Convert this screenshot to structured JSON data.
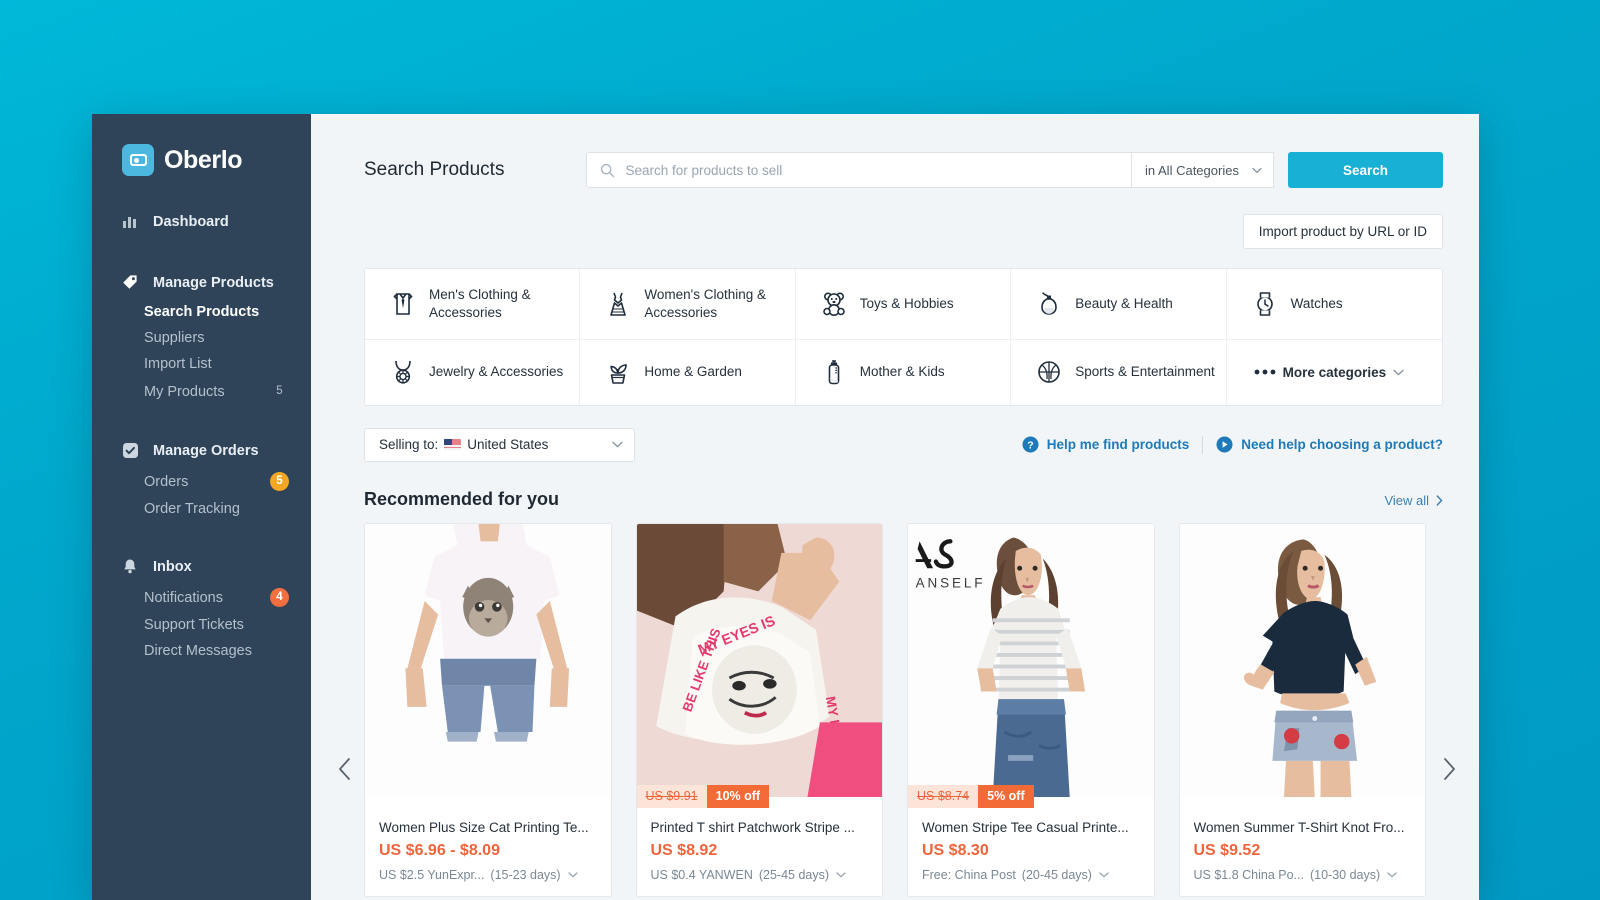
{
  "brand": {
    "name": "Oberlo",
    "logo_icon": "oberlo-logo-icon",
    "accent": "#4cb8e0"
  },
  "sidebar": {
    "groups": [
      {
        "label": "Dashboard",
        "icon": "bar-chart-icon",
        "children": []
      },
      {
        "label": "Manage Products",
        "icon": "tag-icon",
        "children": [
          {
            "label": "Search Products",
            "badge": "",
            "active": true
          },
          {
            "label": "Suppliers",
            "badge": "",
            "active": false
          },
          {
            "label": "Import List",
            "badge": "",
            "active": false
          },
          {
            "label": "My Products",
            "badge": "5",
            "badge_style": "plain",
            "active": false
          }
        ]
      },
      {
        "label": "Manage Orders",
        "icon": "check-square-icon",
        "children": [
          {
            "label": "Orders",
            "badge": "5",
            "badge_style": "amber",
            "active": false
          },
          {
            "label": "Order Tracking",
            "badge": "",
            "active": false
          }
        ]
      },
      {
        "label": "Inbox",
        "icon": "bell-icon",
        "children": [
          {
            "label": "Notifications",
            "badge": "4",
            "badge_style": "orange",
            "active": false
          },
          {
            "label": "Support Tickets",
            "badge": "",
            "active": false
          },
          {
            "label": "Direct Messages",
            "badge": "",
            "active": false
          }
        ]
      }
    ]
  },
  "header": {
    "page_title": "Search Products",
    "search": {
      "value": "",
      "placeholder": "Search for products to sell",
      "icon": "search-icon"
    },
    "category_select": {
      "value": "in All Categories",
      "icon": "chevron-down-icon"
    },
    "search_button": "Search",
    "import_button": "Import product by URL or ID"
  },
  "categories": [
    {
      "label": "Men's Clothing & Accessories",
      "icon": "shirt-tie-icon"
    },
    {
      "label": "Women's Clothing & Accessories",
      "icon": "dress-icon"
    },
    {
      "label": "Toys & Hobbies",
      "icon": "teddy-bear-icon"
    },
    {
      "label": "Beauty & Health",
      "icon": "perfume-bottle-icon"
    },
    {
      "label": "Watches",
      "icon": "watch-icon"
    },
    {
      "label": "Jewelry & Accessories",
      "icon": "necklace-icon"
    },
    {
      "label": "Home & Garden",
      "icon": "potted-plant-icon"
    },
    {
      "label": "Mother & Kids",
      "icon": "baby-bottle-icon"
    },
    {
      "label": "Sports & Entertainment",
      "icon": "basketball-icon"
    },
    {
      "label": "More categories",
      "icon": "ellipsis-icon",
      "is_more": true
    }
  ],
  "selling_to": {
    "prefix": "Selling to:",
    "country": "United States",
    "flag": "us-flag-icon",
    "icon": "chevron-down-icon"
  },
  "help_links": [
    {
      "label": "Help me find products",
      "icon": "question-circle-icon"
    },
    {
      "label": "Need help choosing a product?",
      "icon": "play-circle-icon"
    }
  ],
  "recommended": {
    "title": "Recommended for you",
    "view_all": "View all",
    "prev_icon": "chevron-left-icon",
    "next_icon": "chevron-right-icon",
    "products": [
      {
        "name": "Women Plus Size Cat Printing Te...",
        "price": "US $6.96 - $8.09",
        "shipping_carrier": "US $2.5 YunExpr...",
        "shipping_days": "(15-23 days)",
        "old_price": "",
        "discount": ""
      },
      {
        "name": "Printed T shirt Patchwork Stripe ...",
        "price": "US $8.92",
        "shipping_carrier": "US $0.4 YANWEN",
        "shipping_days": "(25-45 days)",
        "old_price": "US $9.91",
        "discount": "10% off"
      },
      {
        "name": "Women Stripe Tee Casual Printe...",
        "price": "US $8.30",
        "shipping_carrier": "Free: China Post",
        "shipping_days": "(20-45 days)",
        "old_price": "US $8.74",
        "discount": "5% off",
        "watermark": "ANSELF"
      },
      {
        "name": "Women Summer T-Shirt Knot Fro...",
        "price": "US $9.52",
        "shipping_carrier": "US $1.8 China Po...",
        "shipping_days": "(10-30 days)",
        "old_price": "",
        "discount": ""
      }
    ]
  },
  "colors": {
    "sidebar_bg": "#2f4458",
    "accent_cyan": "#19b0d6",
    "price_orange": "#f0643c",
    "link_blue": "#1e7ab8",
    "page_bg": "#f2f5f7"
  }
}
